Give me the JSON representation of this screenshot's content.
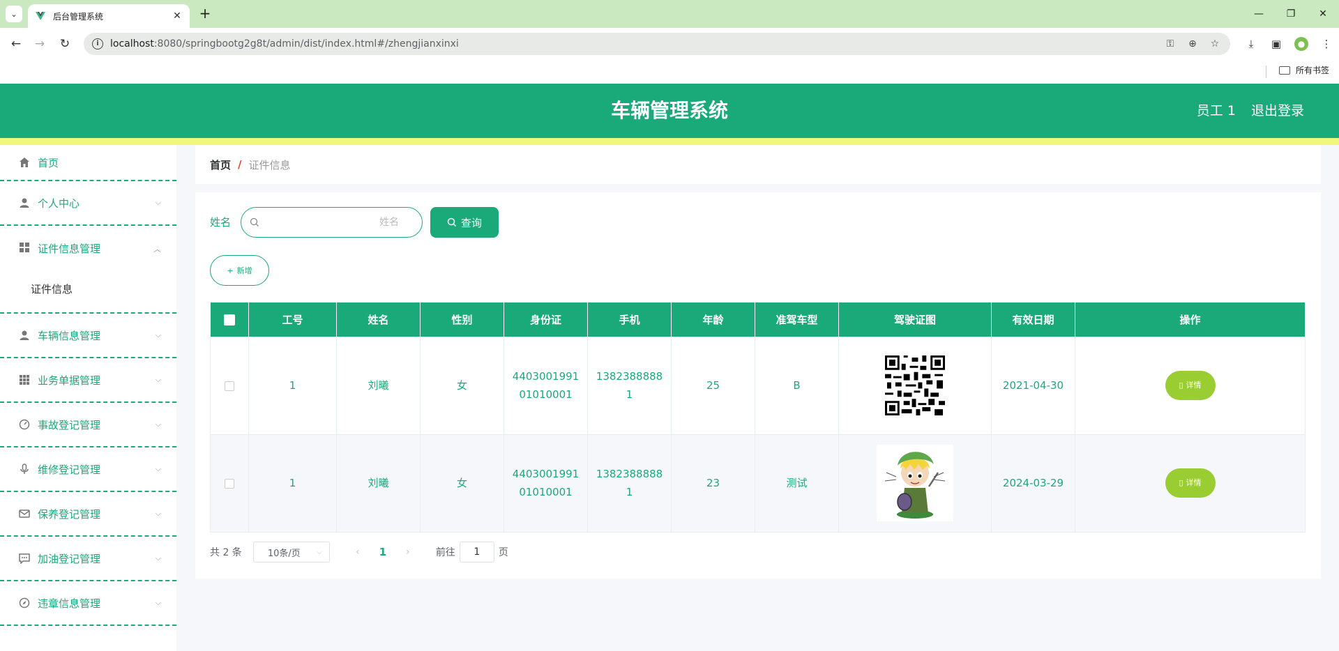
{
  "browser": {
    "tab_title": "后台管理系统",
    "url_host": "localhost",
    "url_path": ":8080/springbootg2g8t/admin/dist/index.html#/zhengjianxinxi",
    "bookmarks_label": "所有书签"
  },
  "header": {
    "title": "车辆管理系统",
    "user": "员工 1",
    "logout": "退出登录"
  },
  "sidebar": {
    "items": [
      {
        "label": "首页"
      },
      {
        "label": "个人中心"
      },
      {
        "label": "证件信息管理"
      },
      {
        "label": "车辆信息管理"
      },
      {
        "label": "业务单据管理"
      },
      {
        "label": "事故登记管理"
      },
      {
        "label": "维修登记管理"
      },
      {
        "label": "保养登记管理"
      },
      {
        "label": "加油登记管理"
      },
      {
        "label": "违章信息管理"
      }
    ],
    "sub_item": "证件信息"
  },
  "breadcrumb": {
    "home": "首页",
    "sep": "/",
    "current": "证件信息"
  },
  "search": {
    "label": "姓名",
    "placeholder": "姓名",
    "button": "查询"
  },
  "add_button": "新增",
  "table": {
    "columns": [
      "工号",
      "姓名",
      "性别",
      "身份证",
      "手机",
      "年龄",
      "准驾车型",
      "驾驶证图",
      "有效日期",
      "操作"
    ],
    "rows": [
      {
        "id": "1",
        "name": "刘曦",
        "gender": "女",
        "idcard": "440300199101010001",
        "phone": "13823888881",
        "age": "25",
        "license_type": "B",
        "date": "2021-04-30",
        "action": "详情"
      },
      {
        "id": "1",
        "name": "刘曦",
        "gender": "女",
        "idcard": "440300199101010001",
        "phone": "13823888881",
        "age": "23",
        "license_type": "测试",
        "date": "2024-03-29",
        "action": "详情"
      }
    ]
  },
  "pager": {
    "total": "共 2 条",
    "page_size": "10条/页",
    "current": "1",
    "goto_prefix": "前往",
    "goto_value": "1",
    "goto_suffix": "页"
  }
}
